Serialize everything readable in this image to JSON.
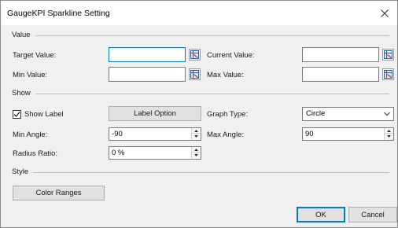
{
  "window": {
    "title": "GaugeKPI Sparkline Setting"
  },
  "value_section": {
    "header": "Value",
    "target_label": "Target Value:",
    "target_value": "",
    "current_label": "Current Value:",
    "current_value": "",
    "min_label": "Min Value:",
    "min_value": "",
    "max_label": "Max Value:",
    "max_value": ""
  },
  "show_section": {
    "header": "Show",
    "show_label_text": "Show Label",
    "show_label_checked": true,
    "label_option_button": "Label Option",
    "graph_type_label": "Graph Type:",
    "graph_type_value": "Circle",
    "min_angle_label": "Min Angle:",
    "min_angle_value": "-90",
    "max_angle_label": "Max Angle:",
    "max_angle_value": "90",
    "radius_ratio_label": "Radius Ratio:",
    "radius_ratio_value": "0 %"
  },
  "style_section": {
    "header": "Style",
    "color_ranges_button": "Color Ranges"
  },
  "footer": {
    "ok": "OK",
    "cancel": "Cancel"
  },
  "icons": {
    "close": "close-icon",
    "range_picker": "range-picker-icon",
    "checkmark": "checkmark-icon",
    "spin_up": "chevron-up-icon",
    "spin_down": "chevron-down-icon",
    "dropdown": "chevron-down-icon"
  },
  "colors": {
    "accent": "#0078d7",
    "dialog_bg": "#f0f0f0"
  }
}
